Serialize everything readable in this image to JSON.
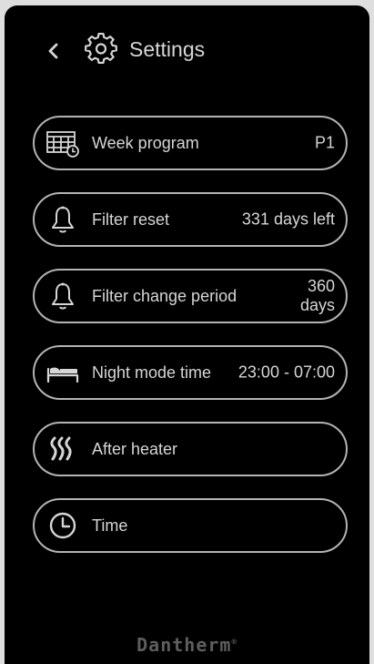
{
  "header": {
    "title": "Settings",
    "back_icon": "chevron-left-icon",
    "title_icon": "gear-icon"
  },
  "menu": {
    "items": [
      {
        "icon": "calendar-clock-icon",
        "label": "Week program",
        "value": "P1"
      },
      {
        "icon": "bell-icon",
        "label": "Filter reset",
        "value": "331 days left"
      },
      {
        "icon": "bell-icon",
        "label": "Filter change period",
        "value": "360 days"
      },
      {
        "icon": "bed-icon",
        "label": "Night mode time",
        "value": "23:00 - 07:00"
      },
      {
        "icon": "heater-waves-icon",
        "label": "After heater",
        "value": ""
      },
      {
        "icon": "clock-icon",
        "label": "Time",
        "value": ""
      }
    ]
  },
  "brand": {
    "name": "Dantherm",
    "reg_mark": "®"
  },
  "colors": {
    "background": "#000000",
    "text": "#d6d6d6",
    "border": "#b4b4b4",
    "logo": "#5e5e5e"
  }
}
